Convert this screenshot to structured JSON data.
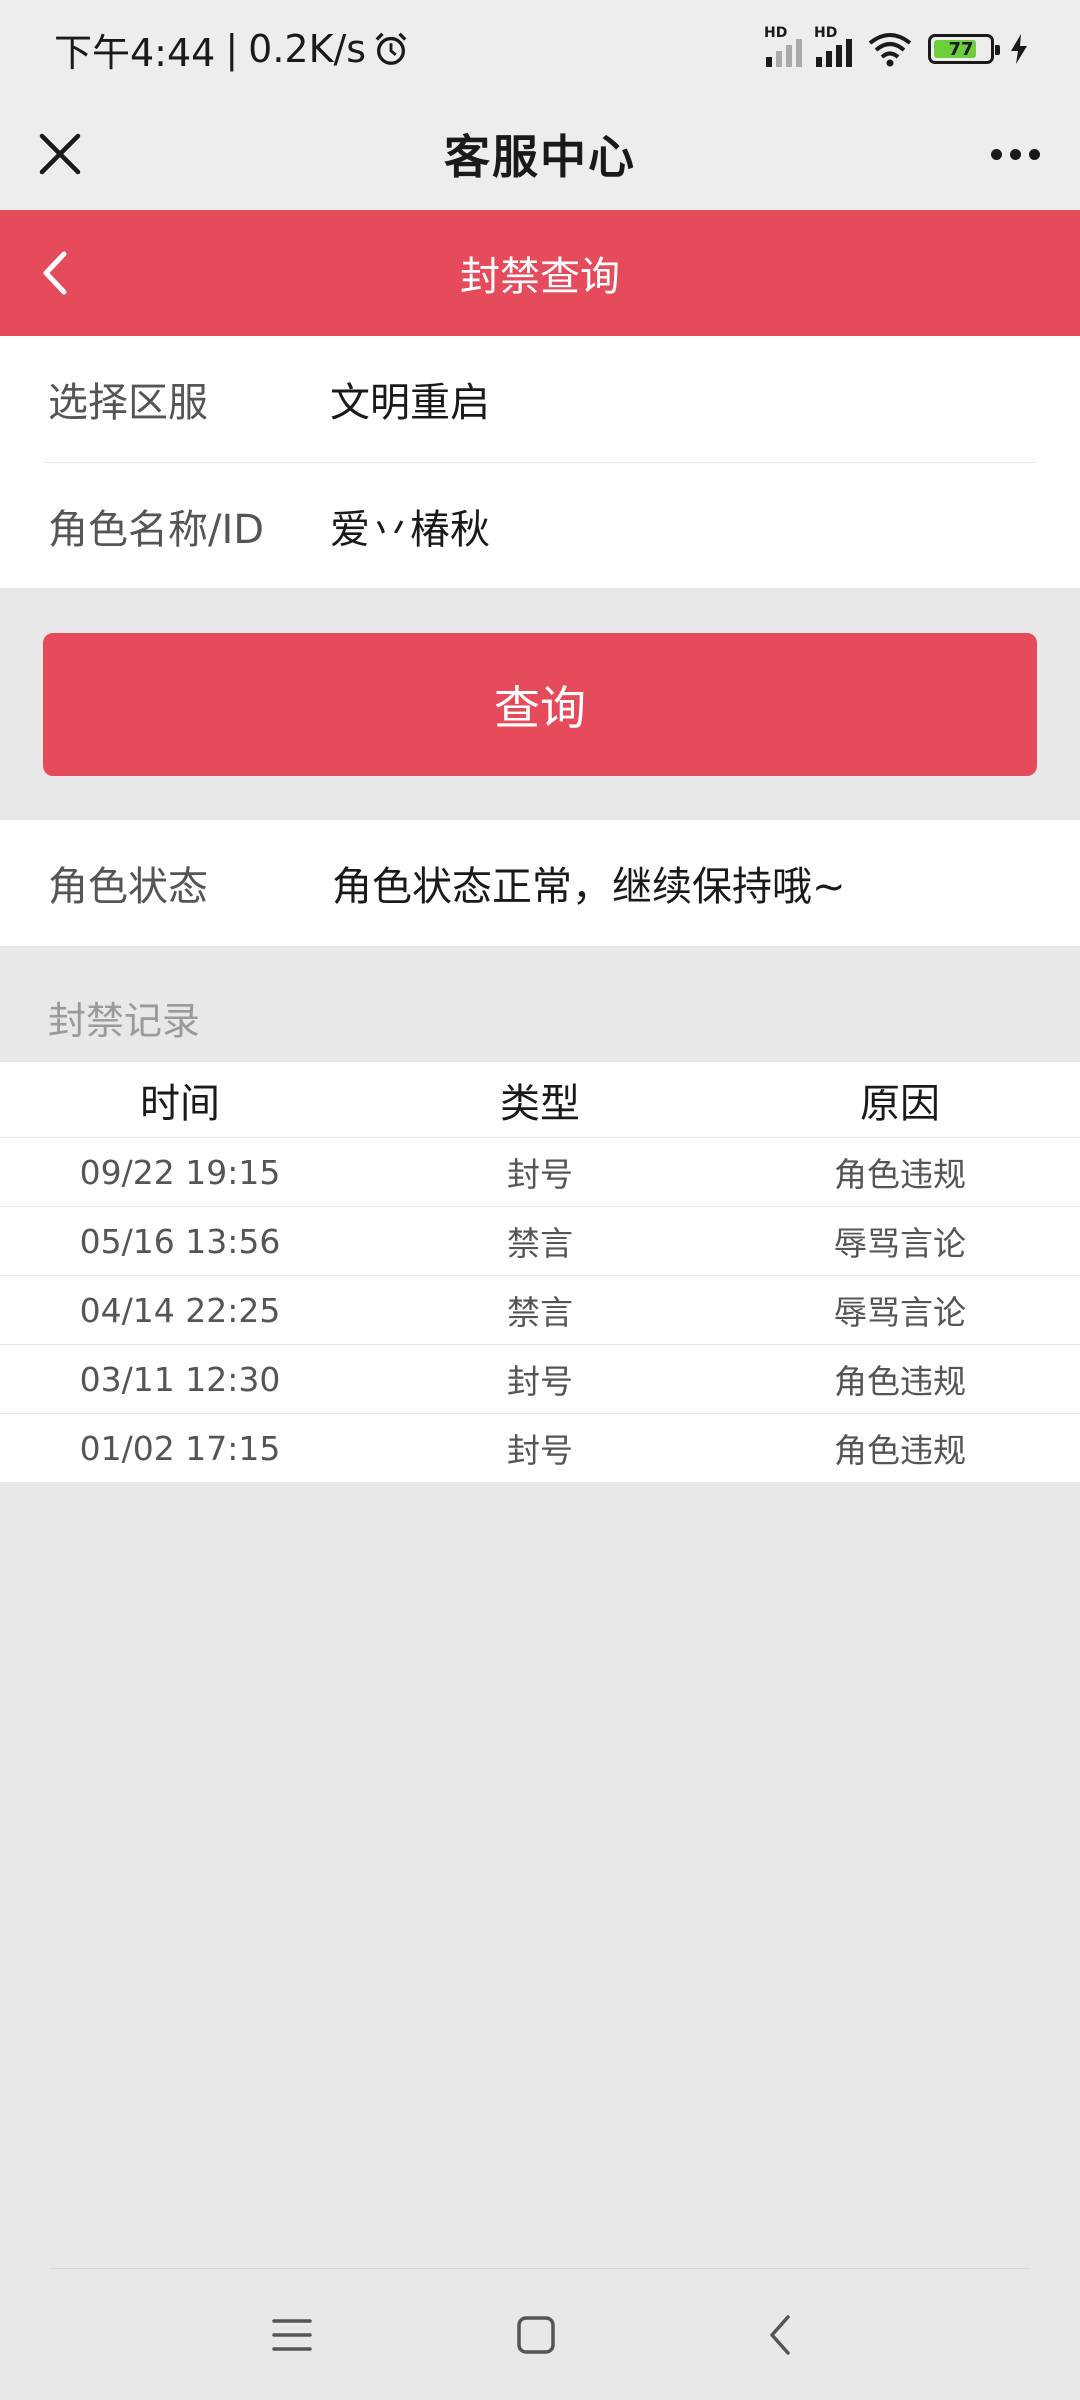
{
  "status_bar": {
    "time": "下午4:44",
    "separator": "|",
    "speed": "0.2K/s",
    "hd1": "HD",
    "hd2": "HD",
    "battery": "77"
  },
  "title_bar": {
    "title": "客服中心"
  },
  "header": {
    "title": "封禁查询"
  },
  "form": {
    "server_label": "选择区服",
    "server_value": "文明重启",
    "role_label": "角色名称/ID",
    "role_value": "爱丷椿秋"
  },
  "query_button": "查询",
  "role_status": {
    "label": "角色状态",
    "value": "角色状态正常，继续保持哦~"
  },
  "records": {
    "title": "封禁记录",
    "headers": [
      "时间",
      "类型",
      "原因"
    ],
    "rows": [
      [
        "09/22 19:15",
        "封号",
        "角色违规"
      ],
      [
        "05/16 13:56",
        "禁言",
        "辱骂言论"
      ],
      [
        "04/14 22:25",
        "禁言",
        "辱骂言论"
      ],
      [
        "03/11 12:30",
        "封号",
        "角色违规"
      ],
      [
        "01/02 17:15",
        "封号",
        "角色违规"
      ]
    ]
  },
  "colors": {
    "accent": "#e64b5c",
    "background": "#e8e8e8"
  }
}
